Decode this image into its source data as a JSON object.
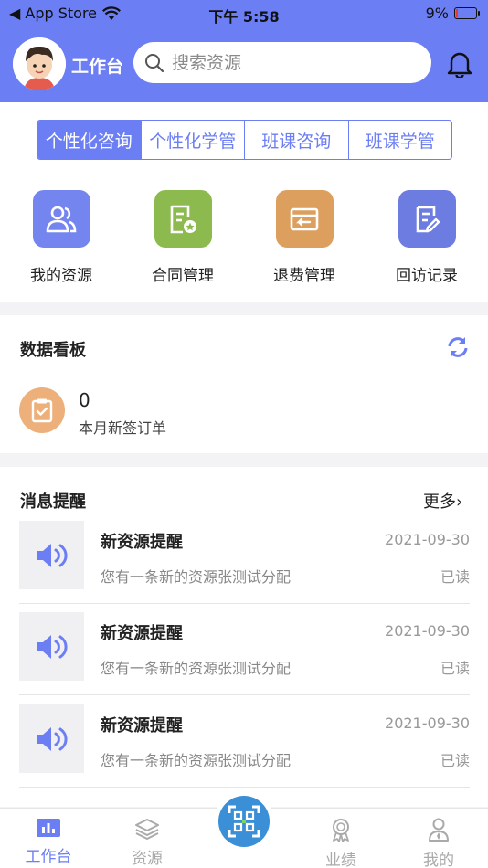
{
  "status_bar": {
    "back_label": "◀ App Store",
    "time": "下午 5:58",
    "battery": "9%",
    "battery_level": 0.09
  },
  "header": {
    "title": "工作台",
    "search_placeholder": "搜索资源"
  },
  "segments": [
    {
      "label": "个性化咨询",
      "active": true
    },
    {
      "label": "个性化学管",
      "active": false
    },
    {
      "label": "班课咨询",
      "active": false
    },
    {
      "label": "班课学管",
      "active": false
    }
  ],
  "quick_actions": [
    {
      "label": "我的资源",
      "icon": "users-icon",
      "color": "#7585f0"
    },
    {
      "label": "合同管理",
      "icon": "contract-icon",
      "color": "#8cba4e"
    },
    {
      "label": "退费管理",
      "icon": "refund-icon",
      "color": "#dd9f5e"
    },
    {
      "label": "回访记录",
      "icon": "notes-icon",
      "color": "#6c7ce0"
    }
  ],
  "dashboard": {
    "title": "数据看板",
    "stat_value": "0",
    "stat_label": "本月新签订单"
  },
  "messages": {
    "title": "消息提醒",
    "more_label": "更多",
    "items": [
      {
        "title": "新资源提醒",
        "date": "2021-09-30",
        "summary": "您有一条新的资源张测试分配",
        "status": "已读"
      },
      {
        "title": "新资源提醒",
        "date": "2021-09-30",
        "summary": "您有一条新的资源张测试分配",
        "status": "已读"
      },
      {
        "title": "新资源提醒",
        "date": "2021-09-30",
        "summary": "您有一条新的资源张测试分配",
        "status": "已读"
      }
    ]
  },
  "tabbar": [
    {
      "label": "工作台",
      "icon": "chart-icon",
      "active": true
    },
    {
      "label": "资源",
      "icon": "layers-icon",
      "active": false
    },
    {
      "label": "业绩",
      "icon": "award-icon",
      "active": false
    },
    {
      "label": "我的",
      "icon": "user-icon",
      "active": false
    }
  ],
  "colors": {
    "primary": "#6b7ef3",
    "scan": "#3b8fd6"
  }
}
